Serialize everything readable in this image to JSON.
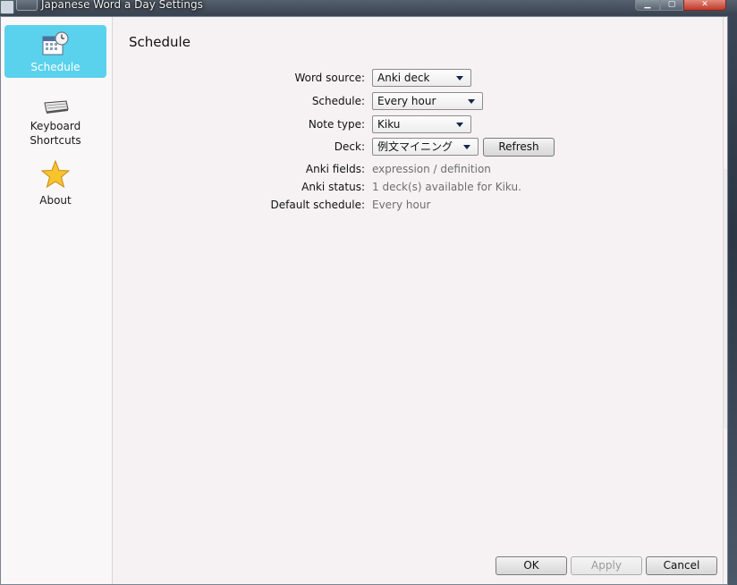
{
  "window": {
    "title": "Japanese Word a Day Settings"
  },
  "sidebar": {
    "items": [
      {
        "label": "Schedule",
        "icon": "calendar-clock-icon",
        "active": true
      },
      {
        "label": "Keyboard Shortcuts",
        "label_lines": [
          "Keyboard",
          "Shortcuts"
        ],
        "icon": "keyboard-icon",
        "active": false
      },
      {
        "label": "About",
        "icon": "star-icon",
        "active": false
      }
    ],
    "active_color": "#5ad2ed"
  },
  "main": {
    "title": "Schedule",
    "fields": {
      "word_source": {
        "label": "Word source:",
        "value": "Anki deck"
      },
      "schedule": {
        "label": "Schedule:",
        "value": "Every hour"
      },
      "note_type": {
        "label": "Note type:",
        "value": "Kiku"
      },
      "deck": {
        "label": "Deck:",
        "value": "例文マイニング",
        "refresh_label": "Refresh"
      },
      "anki_fields": {
        "label": "Anki fields:",
        "value": "expression / definition"
      },
      "anki_status": {
        "label": "Anki status:",
        "value": "1 deck(s) available for Kiku."
      },
      "default_schedule": {
        "label": "Default schedule:",
        "value": "Every hour"
      }
    }
  },
  "footer": {
    "ok_label": "OK",
    "apply_label": "Apply",
    "cancel_label": "Cancel"
  }
}
